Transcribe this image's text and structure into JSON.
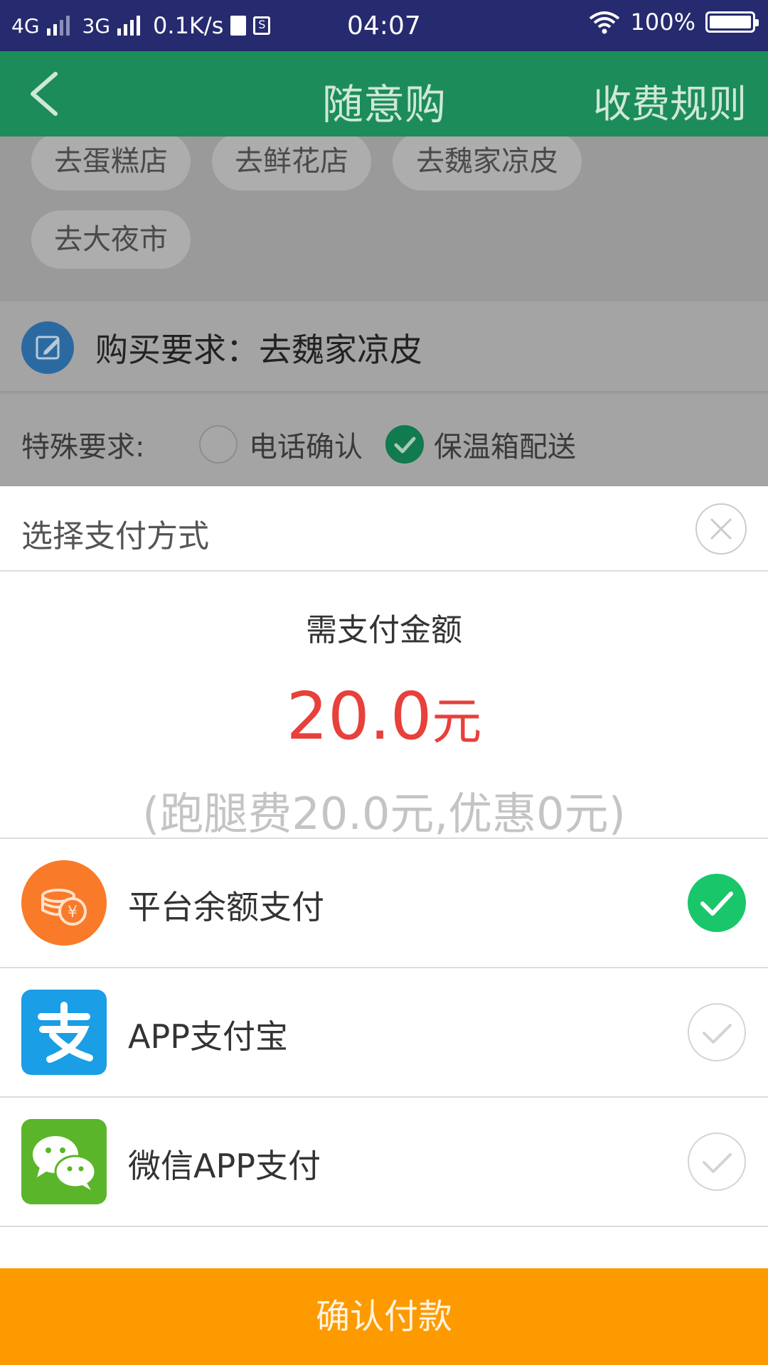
{
  "status_bar": {
    "net1": "4G",
    "net2": "3G",
    "speed": "0.1K/s",
    "sim_icon": "S",
    "time": "04:07",
    "battery": "100%"
  },
  "app_bar": {
    "back_icon": "chevron-left-icon",
    "title": "随意购",
    "rules": "收费规则"
  },
  "chips": [
    "去蛋糕店",
    "去鲜花店",
    "去魏家凉皮",
    "去大夜市"
  ],
  "purchase": {
    "label": "购买要求：去魏家凉皮"
  },
  "special": {
    "label": "特殊要求:",
    "options": [
      {
        "label": "电话确认",
        "checked": false
      },
      {
        "label": "保温箱配送",
        "checked": true
      }
    ]
  },
  "sheet": {
    "title": "选择支付方式",
    "amount_label": "需支付金额",
    "amount_number": "20.0",
    "amount_unit": "元",
    "amount_detail": "(跑腿费20.0元,优惠0元)",
    "methods": [
      {
        "label": "平台余额支付",
        "icon": "coin-wallet-icon",
        "selected": true
      },
      {
        "label": "APP支付宝",
        "icon": "alipay-icon",
        "selected": false
      },
      {
        "label": "微信APP支付",
        "icon": "wechat-icon",
        "selected": false
      }
    ],
    "confirm": "确认付款"
  },
  "colors": {
    "status_bar": "#262a6e",
    "app_bar": "#1c8c5a",
    "amount": "#e8403a",
    "confirm": "#fd9a00",
    "selected_check": "#19c76a",
    "alipay": "#1a9ee6",
    "wechat": "#5bb52a",
    "balance": "#f97a28"
  }
}
